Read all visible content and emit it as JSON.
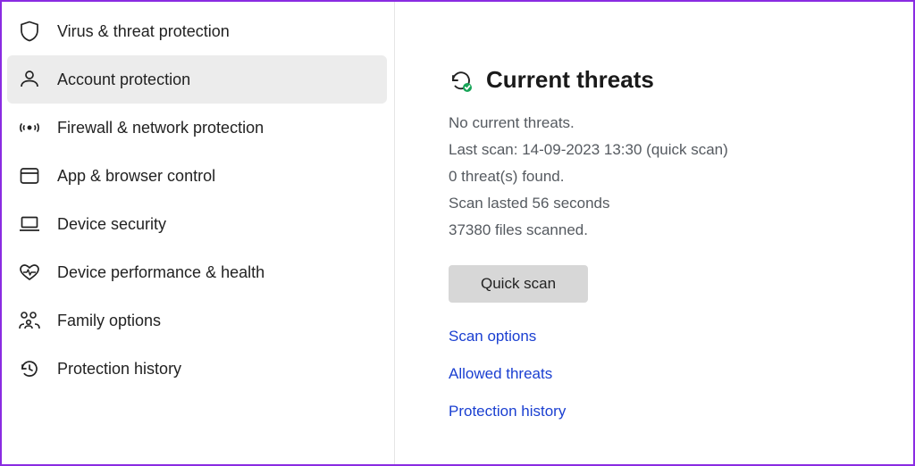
{
  "sidebar": {
    "items": [
      {
        "label": "Virus & threat protection"
      },
      {
        "label": "Account protection"
      },
      {
        "label": "Firewall & network protection"
      },
      {
        "label": "App & browser control"
      },
      {
        "label": "Device security"
      },
      {
        "label": "Device performance & health"
      },
      {
        "label": "Family options"
      },
      {
        "label": "Protection history"
      }
    ],
    "selected_index": 1
  },
  "threats": {
    "heading": "Current threats",
    "no_threats": "No current threats.",
    "last_scan": "Last scan: 14-09-2023 13:30 (quick scan)",
    "found": "0 threat(s) found.",
    "duration": "Scan lasted 56 seconds",
    "files": "37380 files scanned.",
    "quick_scan_button": "Quick scan",
    "links": {
      "scan_options": "Scan options",
      "allowed_threats": "Allowed threats",
      "protection_history": "Protection history"
    }
  }
}
